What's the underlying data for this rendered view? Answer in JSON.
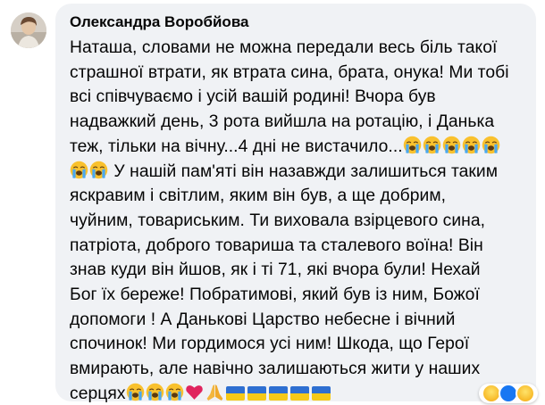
{
  "comment": {
    "author": "Олександра Воробйова",
    "avatar_icon": "user-avatar",
    "line_1": "Наташа, словами не можна передали весь біль такої",
    "line_2": "страшної втрати, як втрата сина, брата, онука! Ми тобі",
    "line_3": "всі співчуваємо і усій вашій родині! Вчора був",
    "line_4": "надважкий день, 3 рота вийшла на ротацію, і Данька",
    "line_5": "теж, тільки на вічну...4 дні не вистачило...",
    "line_6": "У нашій пам'яті він назавжди залишиться таким",
    "line_7": "яскравим і світлим, яким він був, а ще добрим,",
    "line_8": "чуйним, товариським. Ти виховала взірцевого сина,",
    "line_9": "патріота, доброго товариша та сталевого воїна! Він",
    "line_10": "знав куди він йшов, як і ті 71, які вчора були! Нехай",
    "line_11": "Бог їх береже! Побратимові, який був із ним, Божої",
    "line_12": "допомоги ! А Данькові Царство небесне і вічний",
    "line_13": "спочинок! Ми гордимося усі ним! Шкода, що Герої",
    "line_14": "вмирають, але навічно залишаються жити у наших",
    "line_15": "серцях",
    "emoji_names": [
      "crying-face-icon",
      "red-heart-icon",
      "folded-hands-icon",
      "ukraine-flag-icon"
    ],
    "reactions": [
      "sad-reaction-icon",
      "like-reaction-icon",
      "care-reaction-icon"
    ]
  },
  "colors": {
    "bubble_bg": "#f0f2f5",
    "text": "#050505",
    "flag_blue": "#2e6fd1",
    "flag_yellow": "#f5c918",
    "heart": "#e0245e"
  }
}
